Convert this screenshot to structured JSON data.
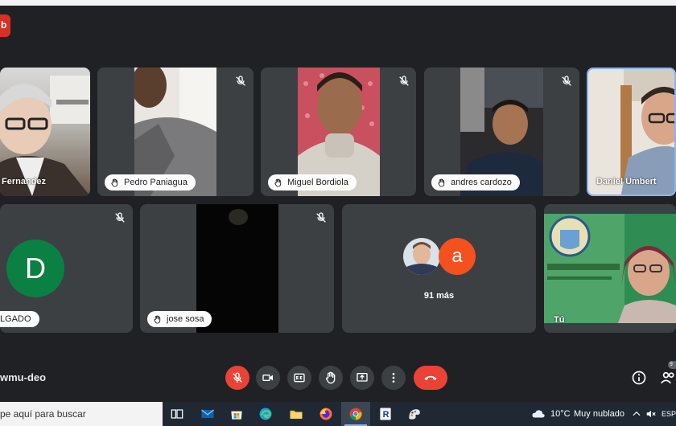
{
  "record_label": "b",
  "participants": [
    {
      "name": "Fernandez",
      "muted": false
    },
    {
      "name": "Pedro Paniagua",
      "muted": true
    },
    {
      "name": "Miguel Bordiola",
      "muted": true
    },
    {
      "name": "andres cardozo",
      "muted": true
    },
    {
      "name": "Daniel Umbert",
      "muted": false,
      "speaking": true
    },
    {
      "name": "LGADO",
      "avatar_letter": "D",
      "muted": true
    },
    {
      "name": "jose sosa",
      "muted": true
    }
  ],
  "more": {
    "letter": "a",
    "label": "91 más"
  },
  "self": {
    "name": "Tú"
  },
  "meeting_code": "wmu-deo",
  "controls": [
    "mic-off",
    "camera",
    "captions",
    "raise-hand",
    "present",
    "more-options",
    "leave-call"
  ],
  "people_badge": "9",
  "colors": {
    "background": "#202124",
    "tile": "#3c4043",
    "danger": "#ea4335",
    "avatar_green": "#0b8043",
    "avatar_orange": "#f4511e",
    "active_border": "#8ab4f8"
  },
  "taskbar": {
    "search_placeholder": "pe aquí para buscar",
    "apps": [
      "task-view",
      "mail",
      "store",
      "edge",
      "file-explorer",
      "firefox",
      "chrome",
      "r-app",
      "paint"
    ],
    "temperature": "10°C",
    "weather": "Muy nublado",
    "language": "ESP"
  }
}
